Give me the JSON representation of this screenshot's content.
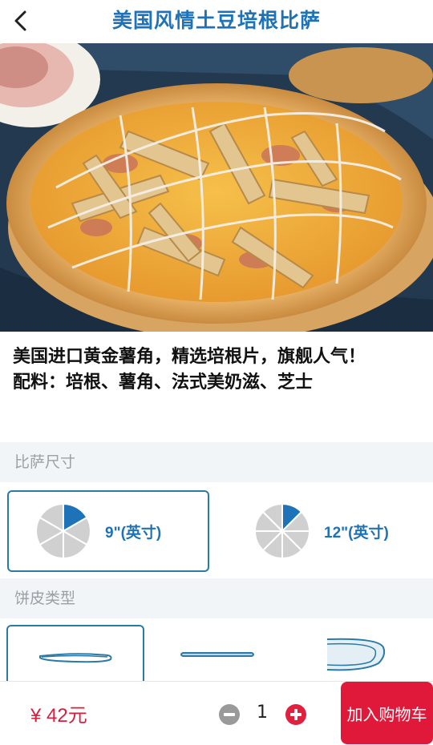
{
  "header": {
    "title": "美国风情土豆培根比萨",
    "back_icon": "chevron-left-icon"
  },
  "hero": {
    "image_alt": "pizza-photo",
    "carousel_pages": 1,
    "carousel_active": 1
  },
  "description": {
    "line1": "美国进口黄金薯角，精选培根片，旗舰人气！",
    "line2": "配料：培根、薯角、法式美奶滋、芝士"
  },
  "size_section": {
    "label": "比萨尺寸",
    "options": [
      {
        "label": "9\"(英寸)",
        "selected": true
      },
      {
        "label": "12\"(英寸)",
        "selected": false
      }
    ]
  },
  "crust_section": {
    "label": "饼皮类型",
    "options": [
      {
        "icon": "thin-crust-icon",
        "selected": true
      },
      {
        "icon": "flat-crust-icon",
        "selected": false
      },
      {
        "icon": "deep-dish-icon",
        "selected": false
      }
    ]
  },
  "footer": {
    "price": "¥ 42元",
    "quantity": "1",
    "minus_icon": "minus-circle-icon",
    "plus_icon": "plus-circle-icon",
    "add_to_cart_label": "加入购物车"
  },
  "colors": {
    "primary_blue": "#1e73b8",
    "accent_red": "#e0193a",
    "section_bg": "#f2f5f7",
    "pie_fill": "#d0d0d0"
  }
}
